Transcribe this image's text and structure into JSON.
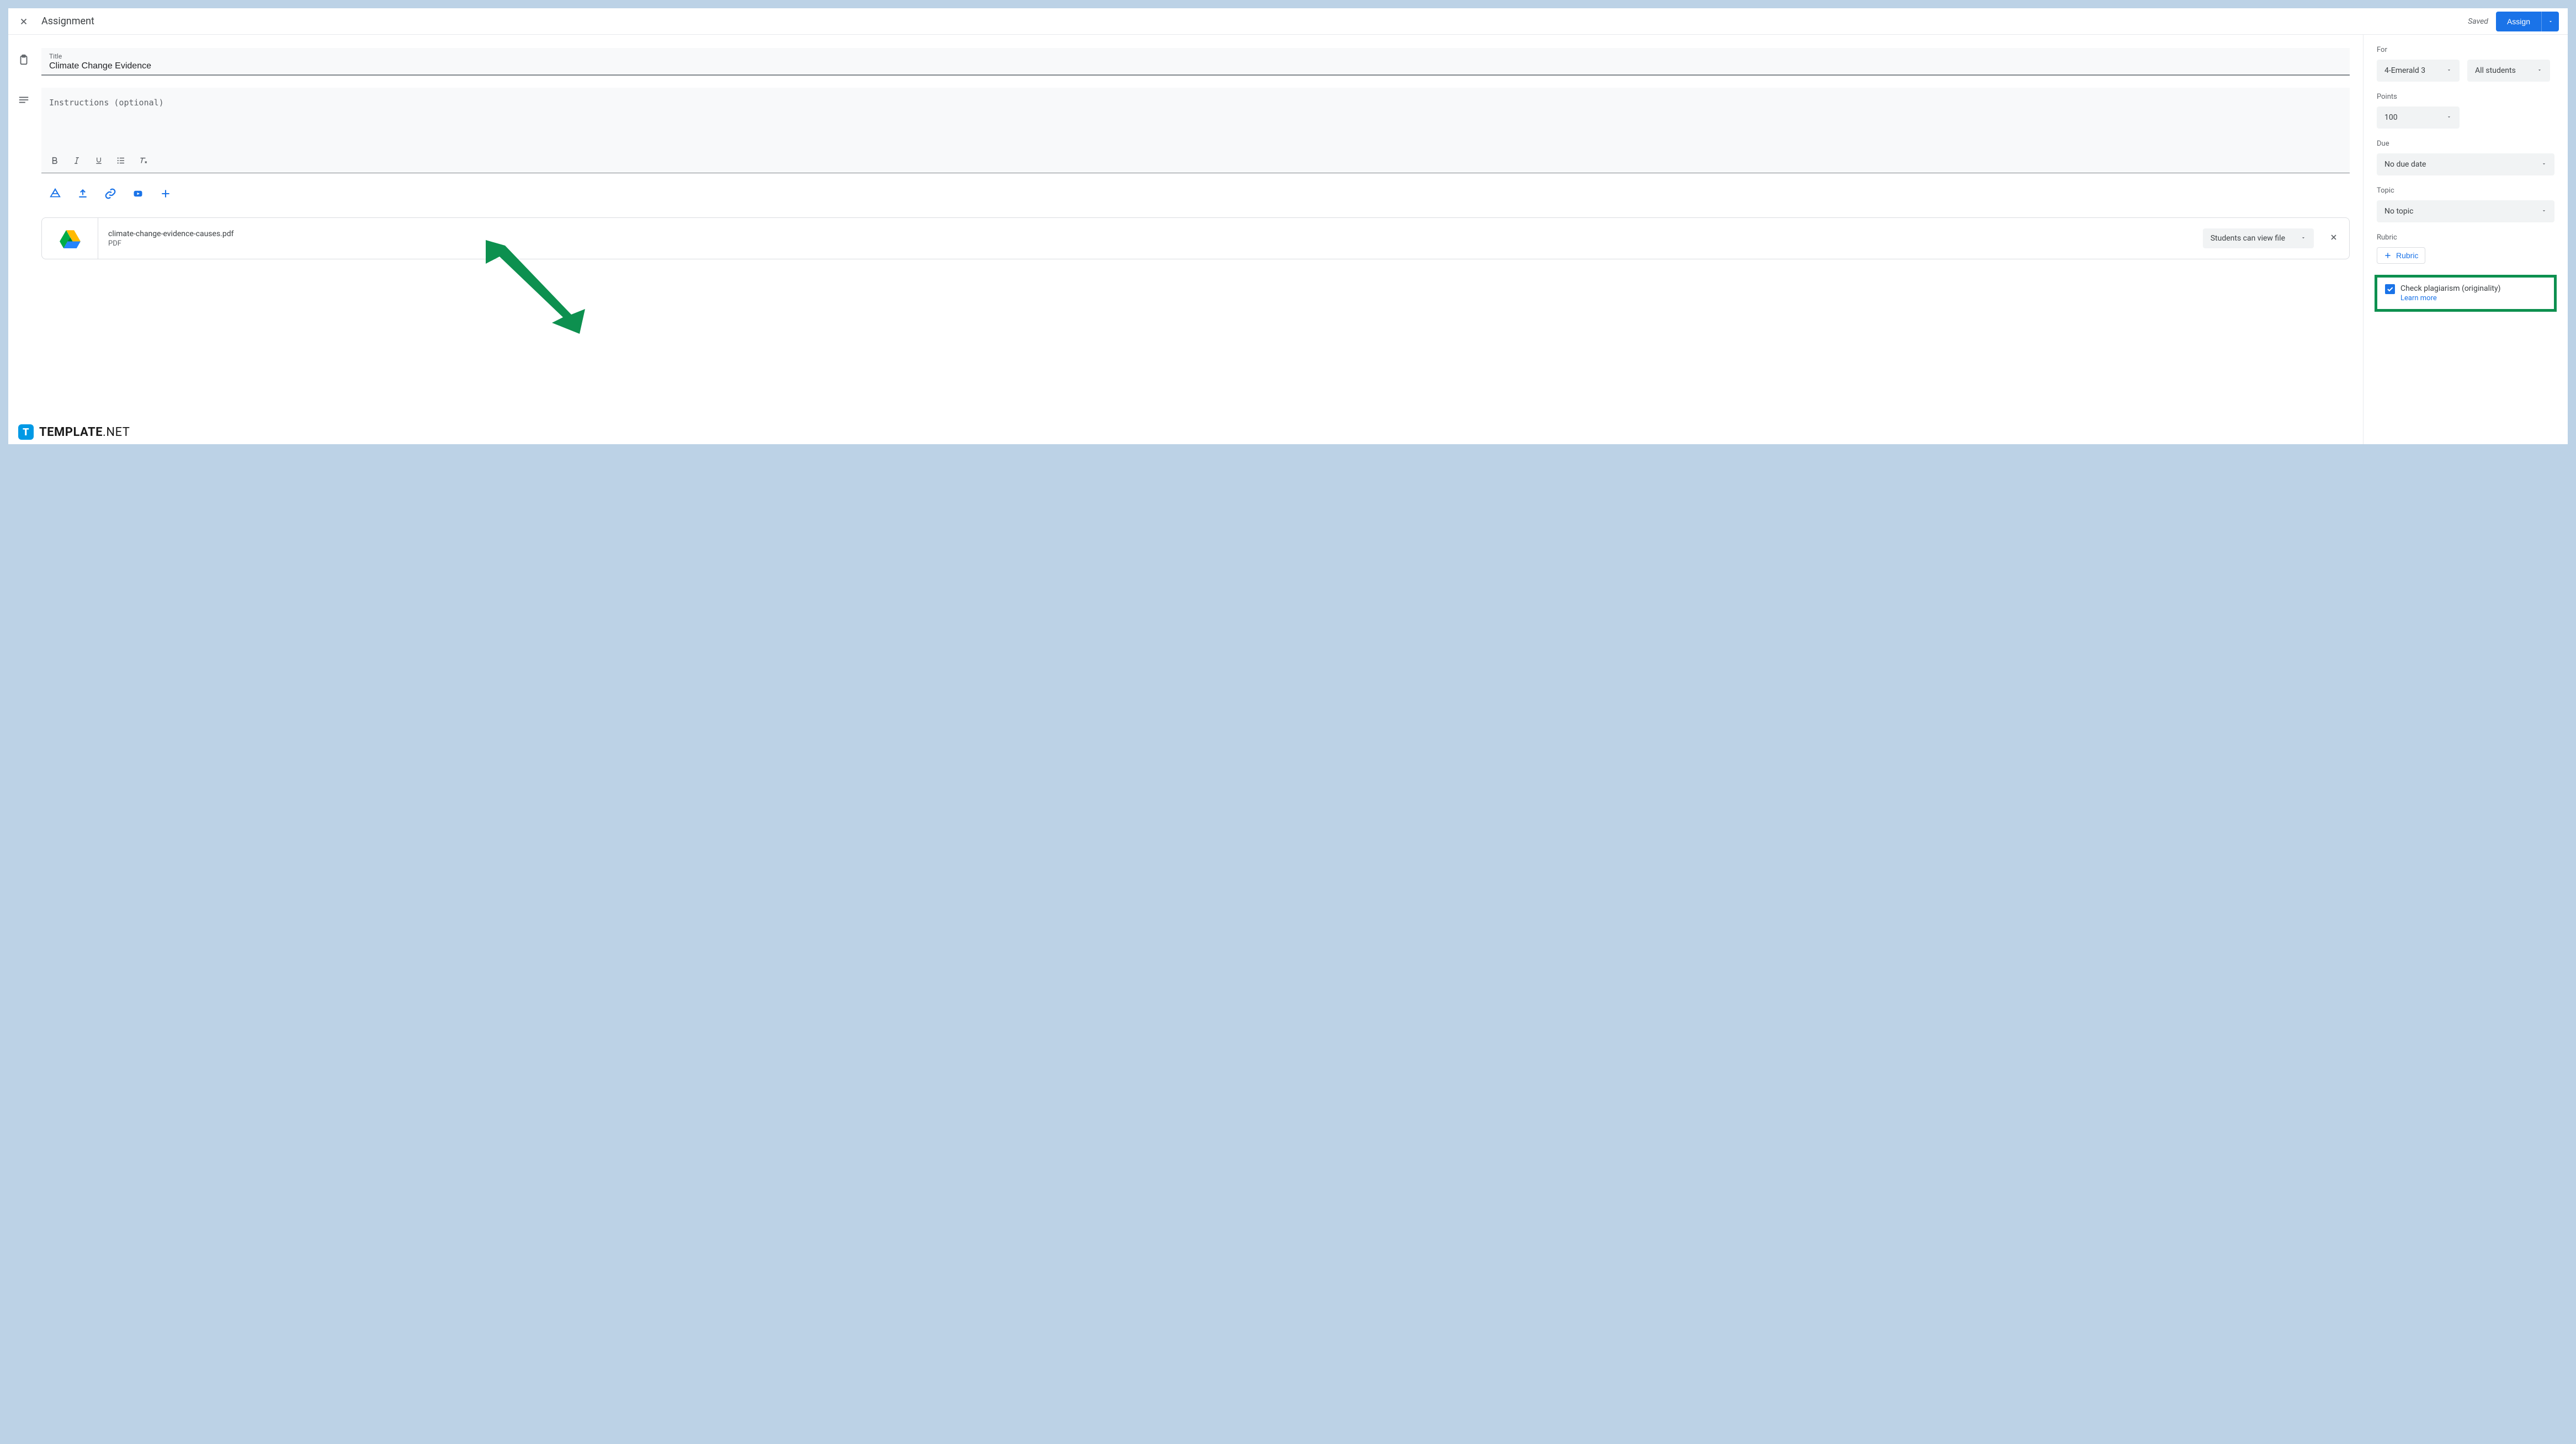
{
  "header": {
    "title": "Assignment",
    "saved": "Saved",
    "assign": "Assign"
  },
  "title_field": {
    "label": "Title",
    "value": "Climate Change Evidence"
  },
  "instructions": {
    "placeholder": "Instructions (optional)"
  },
  "attachment": {
    "filename": "climate-change-evidence-causes.pdf",
    "type": "PDF",
    "access": "Students can view file"
  },
  "sidebar": {
    "for_label": "For",
    "class": "4-Emerald 3",
    "students": "All students",
    "points_label": "Points",
    "points": "100",
    "due_label": "Due",
    "due": "No due date",
    "topic_label": "Topic",
    "topic": "No topic",
    "rubric_label": "Rubric",
    "rubric_btn": "Rubric",
    "originality": "Check plagiarism (originality)",
    "learn_more": "Learn more"
  },
  "watermark": {
    "brand": "TEMPLATE",
    "suffix": ".NET"
  }
}
